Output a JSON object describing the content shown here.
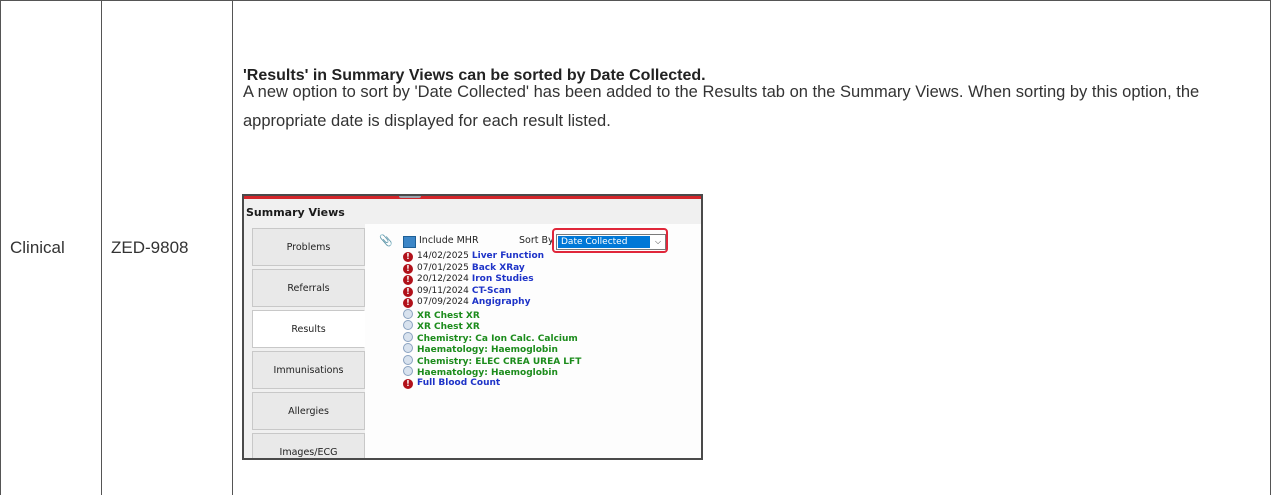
{
  "row": {
    "category": "Clinical",
    "ticket": "ZED-9808",
    "title": "'Results' in Summary Views can be sorted by Date Collected.",
    "description": "A new option to sort by 'Date Collected' has been added to the Results tab on the Summary Views. When sorting by this option, the appropriate date is displayed for each result listed."
  },
  "screenshot": {
    "window_title": "Summary Views",
    "tabs": [
      {
        "label": "Problems"
      },
      {
        "label": "Referrals"
      },
      {
        "label": "Results",
        "active": true
      },
      {
        "label": "Immunisations"
      },
      {
        "label": "Allergies"
      },
      {
        "label": "Images/ECG"
      }
    ],
    "include_mhr_label": "Include MHR",
    "sort_by_label": "Sort By",
    "sort_by_value": "Date Collected",
    "results": [
      {
        "icon": "alert",
        "date": "14/02/2025",
        "name": "Liver Function",
        "color": "blue"
      },
      {
        "icon": "alert",
        "date": "07/01/2025",
        "name": "Back XRay",
        "color": "blue"
      },
      {
        "icon": "alert",
        "date": "20/12/2024",
        "name": "Iron Studies",
        "color": "blue"
      },
      {
        "icon": "alert",
        "date": "09/11/2024",
        "name": "CT-Scan",
        "color": "blue"
      },
      {
        "icon": "alert",
        "date": "07/09/2024",
        "name": "Angigraphy",
        "color": "blue"
      },
      {
        "icon": "clock",
        "date": "",
        "name": "XR Chest XR",
        "color": "green"
      },
      {
        "icon": "clock",
        "date": "",
        "name": "XR Chest XR",
        "color": "green"
      },
      {
        "icon": "clock",
        "date": "",
        "name": "Chemistry: Ca Ion Calc. Calcium",
        "color": "green"
      },
      {
        "icon": "clock",
        "date": "",
        "name": "Haematology: Haemoglobin",
        "color": "green"
      },
      {
        "icon": "clock",
        "date": "",
        "name": "Chemistry: ELEC CREA UREA LFT",
        "color": "green"
      },
      {
        "icon": "clock",
        "date": "",
        "name": "Haematology: Haemoglobin",
        "color": "green"
      },
      {
        "icon": "alert",
        "date": "",
        "name": "Full Blood Count",
        "color": "blue"
      }
    ]
  }
}
